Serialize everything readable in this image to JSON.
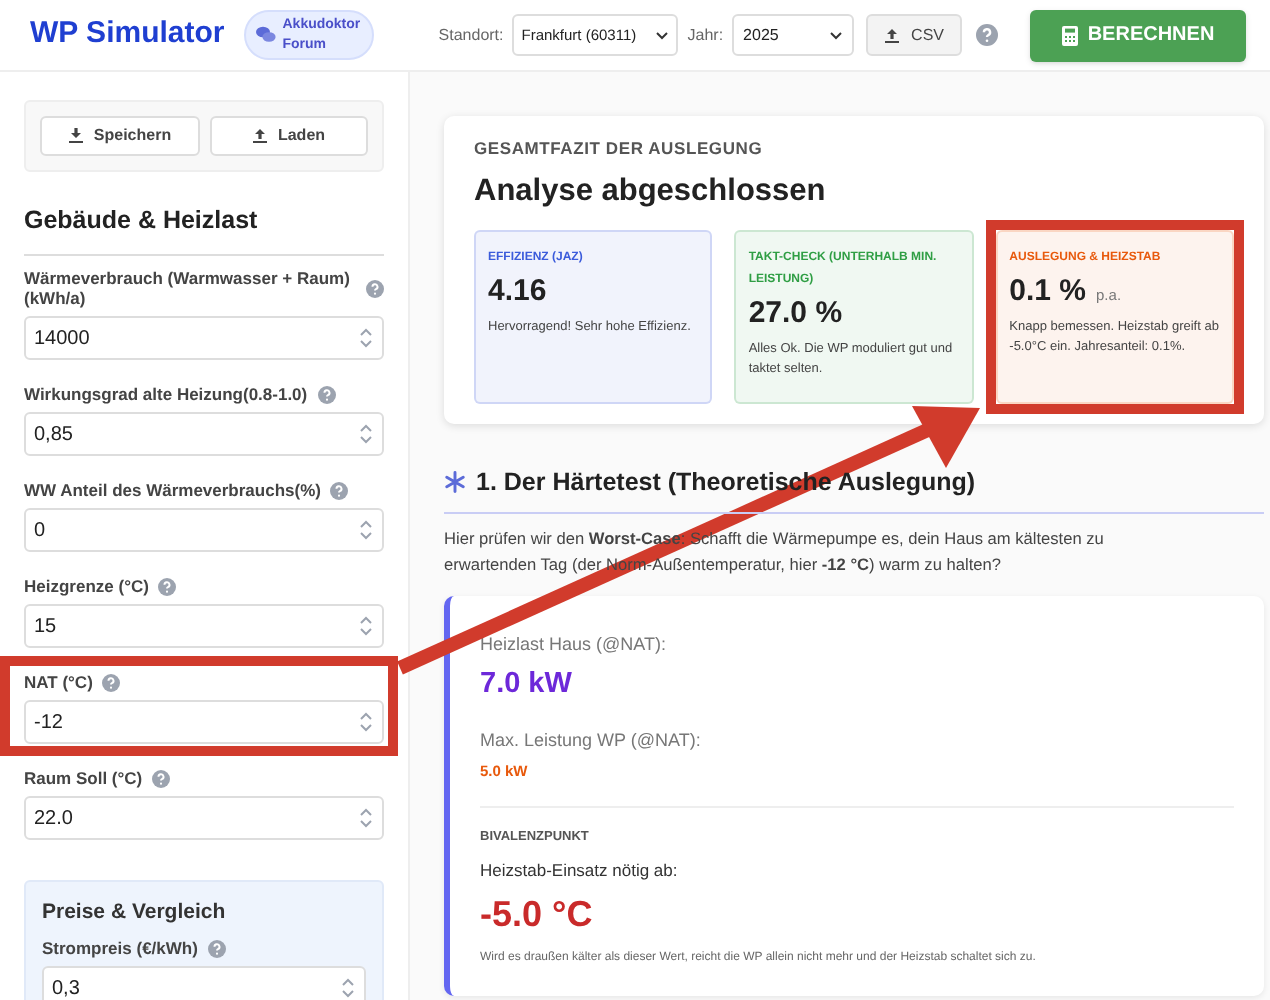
{
  "header": {
    "title": "WP Simulator",
    "forum_badge": "Akkudoktor Forum",
    "location_label": "Standort:",
    "location_value": "Frankfurt (60311)",
    "year_label": "Jahr:",
    "year_value": "2025",
    "csv_button": "CSV",
    "calculate_button": "BERECHNEN"
  },
  "sidebar": {
    "buttons": [
      "Speichern",
      "Laden"
    ],
    "building": {
      "heading": "Gebäude & Heizlast",
      "fields": [
        {
          "label": "Wärmeverbrauch (Warmwasser + Raum) (kWh/a)",
          "value": "14000",
          "help": true
        },
        {
          "label": "Wirkungsgrad alte Heizung(0.8-1.0)",
          "value": "0,85",
          "help": true
        },
        {
          "label": "WW Anteil des Wärmeverbrauchs(%)",
          "value": "0",
          "help": true
        },
        {
          "label": "Heizgrenze (°C)",
          "value": "15",
          "help": true
        },
        {
          "label": "NAT (°C)",
          "value": "-12",
          "help": true,
          "highlighted": true
        },
        {
          "label": "Raum Soll (°C)",
          "value": "22.0",
          "help": true
        }
      ]
    },
    "prices": {
      "heading": "Preise & Vergleich",
      "fields": [
        {
          "label": "Strompreis (€/kWh)",
          "value": "0,3",
          "help": true
        }
      ]
    }
  },
  "summary": {
    "kicker": "GESAMTFAZIT DER AUSLEGUNG",
    "title": "Analyse abgeschlossen",
    "tiles": [
      {
        "color": "#3b5bdb",
        "label": "EFFIZIENZ (JAZ)",
        "value": "4.16",
        "text": "Hervorragend! Sehr hohe Effizienz."
      },
      {
        "color": "#2f9e44",
        "label": "TAKT-CHECK (UNTERHALB MIN. LEISTUNG)",
        "value": "27.0 %",
        "text": "Alles Ok. Die WP moduliert gut und taktet selten."
      },
      {
        "color": "#e8590c",
        "label": "AUSLEGUNG & HEIZSTAB",
        "value": "0.1 %",
        "unit": "p.a.",
        "text": "Knapp bemessen. Heizstab greift ab -5.0°C ein. Jahresanteil: 0.1%.",
        "highlighted": true
      }
    ]
  },
  "hardness_test": {
    "heading": "1. Der Härtetest (Theoretische Auslegung)",
    "intro": "Hier prüfen wir den **Worst-Case**: Schafft die Wärmepumpe es, dein Haus am kältesten zu erwartenden Tag (der Norm-Außentemperatur, hier **-12 °C**) warm zu halten?",
    "heat_load_label": "Heizlast Haus (@NAT):",
    "heat_load_value": "7.0 kW",
    "max_power_label": "Max. Leistung WP (@NAT):",
    "max_power_value": "5.0 kW",
    "bivalence_kicker": "BIVALENZPUNKT",
    "bivalence_label": "Heizstab-Einsatz nötig ab:",
    "bivalence_value": "-5.0 °C",
    "bivalence_note": "Wird es draußen kälter als dieser Wert, reicht die WP allein nicht mehr und der Heizstab schaltet sich zu."
  },
  "annotation": {
    "arrow": true
  }
}
